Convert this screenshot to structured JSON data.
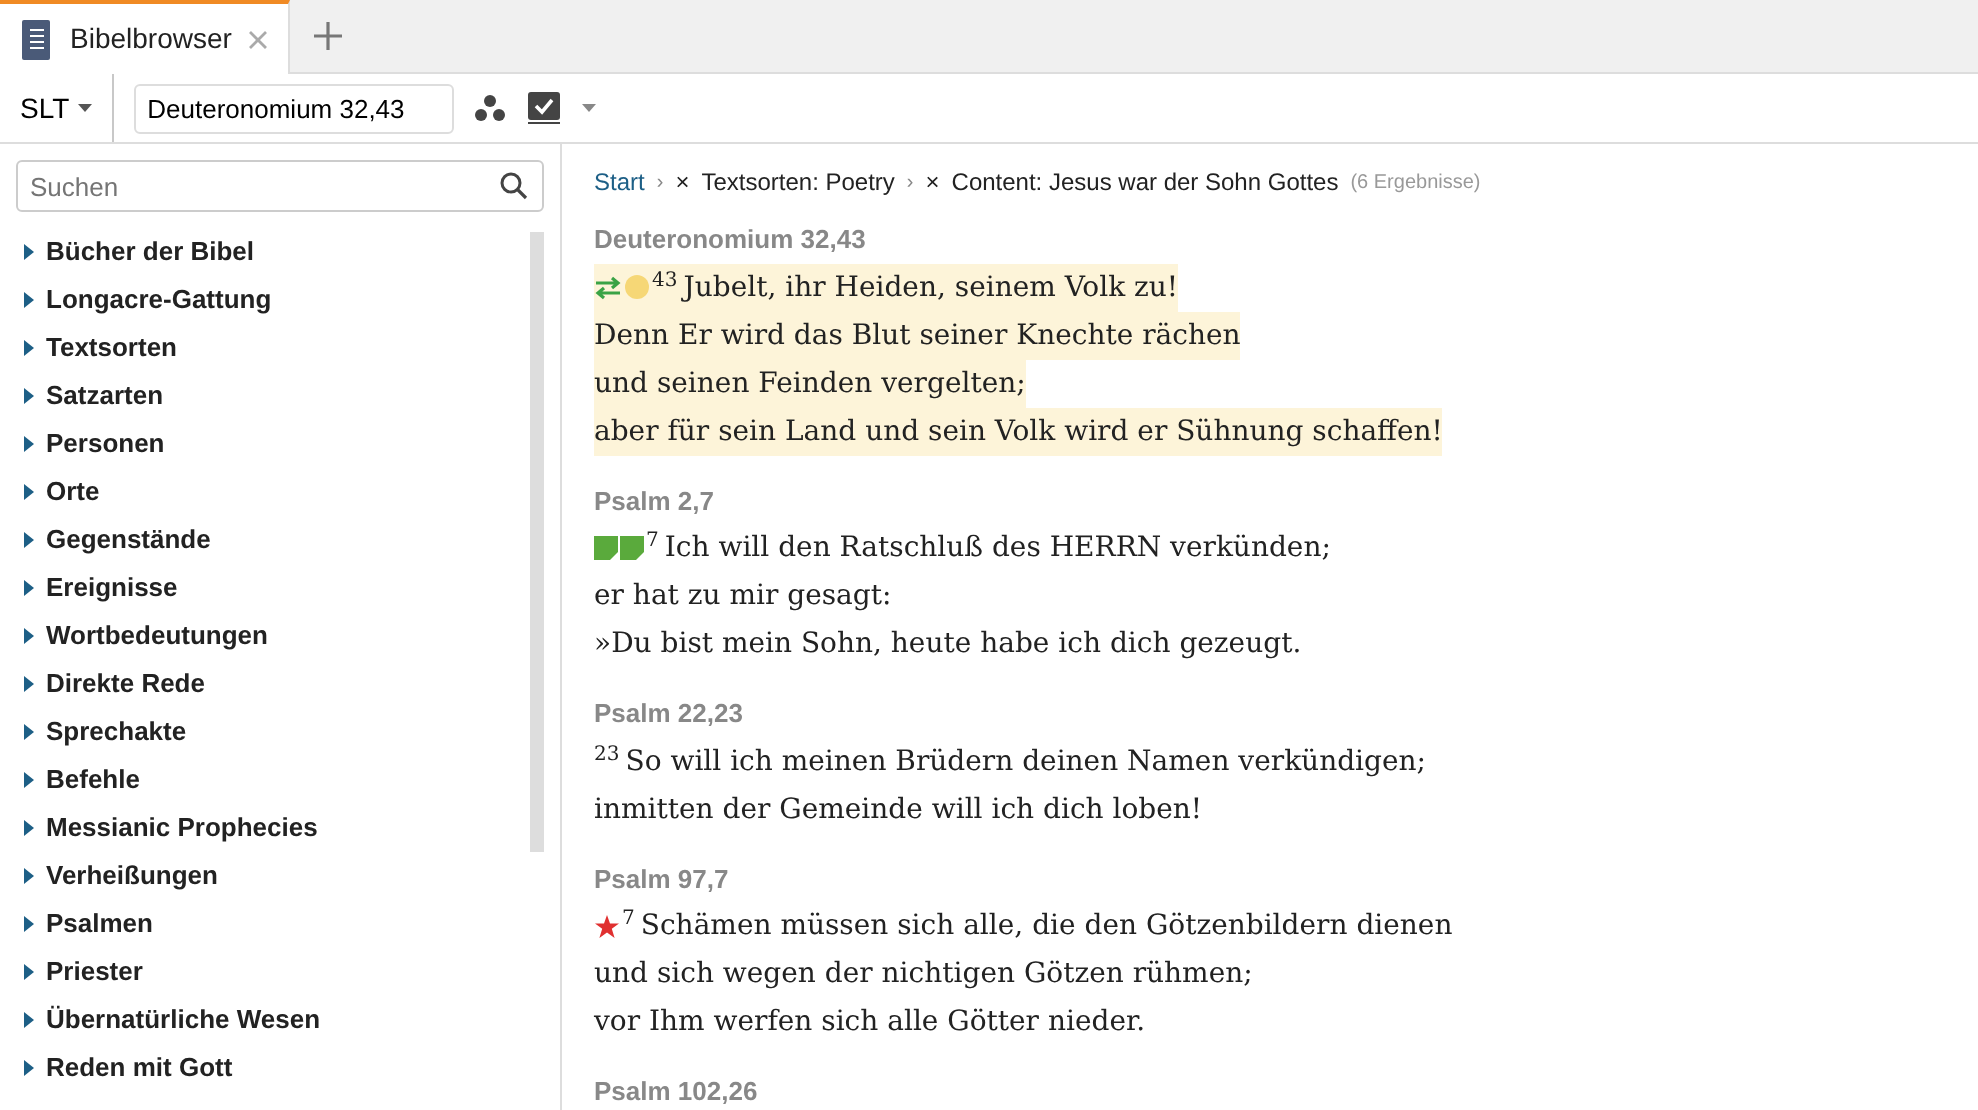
{
  "tabs": [
    {
      "label": "Bibelbrowser",
      "selected": true
    }
  ],
  "toolbar": {
    "translation": "SLT",
    "reference": "Deuteronomium 32,43"
  },
  "sidebar": {
    "search": {
      "placeholder": "Suchen"
    },
    "items": [
      {
        "label": "Bücher der Bibel",
        "expanded": false
      },
      {
        "label": "Longacre-Gattung",
        "expanded": false
      },
      {
        "label": "Textsorten",
        "expanded": false
      },
      {
        "label": "Satzarten",
        "expanded": false
      },
      {
        "label": "Personen",
        "expanded": false
      },
      {
        "label": "Orte",
        "expanded": false
      },
      {
        "label": "Gegenstände",
        "expanded": false
      },
      {
        "label": "Ereignisse",
        "expanded": false
      },
      {
        "label": "Wortbedeutungen",
        "expanded": false
      },
      {
        "label": "Direkte Rede",
        "expanded": false
      },
      {
        "label": "Sprechakte",
        "expanded": false
      },
      {
        "label": "Befehle",
        "expanded": false
      },
      {
        "label": "Messianic Prophecies",
        "expanded": false
      },
      {
        "label": "Verheißungen",
        "expanded": false
      },
      {
        "label": "Psalmen",
        "expanded": false
      },
      {
        "label": "Priester",
        "expanded": false
      },
      {
        "label": "Übernatürliche Wesen",
        "expanded": false
      },
      {
        "label": "Reden mit Gott",
        "expanded": false
      }
    ]
  },
  "breadcrumb": {
    "start": "Start",
    "filters": [
      {
        "separator": "›",
        "remove": "×",
        "label": "Textsorten: Poetry"
      },
      {
        "separator": "›",
        "remove": "×",
        "label": "Content: Jesus war der Sohn Gottes"
      }
    ],
    "count": "(6 Ergebnisse)"
  },
  "passages": [
    {
      "reference": "Deuteronomium 32,43",
      "highlighted": true,
      "markers": [
        {
          "kind": "swap"
        },
        {
          "kind": "dot"
        }
      ],
      "verse": "43",
      "lines": [
        "Jubelt, ihr Heiden, seinem Volk zu!",
        "Denn Er wird das Blut seiner Knechte rächen",
        "und seinen Feinden vergelten;",
        "aber für sein Land und sein Volk wird er Sühnung schaffen!"
      ]
    },
    {
      "reference": "Psalm 2,7",
      "highlighted": false,
      "markers": [
        {
          "kind": "bookmark"
        },
        {
          "kind": "bookmark"
        }
      ],
      "verse": "7",
      "lines": [
        "Ich will den Ratschluß des HERRN verkünden;",
        "er hat zu mir gesagt:",
        "»Du bist mein Sohn, heute habe ich dich gezeugt."
      ]
    },
    {
      "reference": "Psalm 22,23",
      "highlighted": false,
      "verse": "23",
      "lines": [
        "So will ich meinen Brüdern deinen Namen verkündigen;",
        "inmitten der Gemeinde will ich dich loben!"
      ]
    },
    {
      "reference": "Psalm 97,7",
      "highlighted": false,
      "markers": [
        {
          "kind": "star"
        }
      ],
      "verse": "7",
      "lines": [
        "Schämen müssen sich alle, die den Götzenbildern dienen",
        "und sich wegen der nichtigen Götzen rühmen;",
        "vor Ihm werfen sich alle Götter nieder."
      ]
    },
    {
      "reference": "Psalm 102,26"
    }
  ]
}
